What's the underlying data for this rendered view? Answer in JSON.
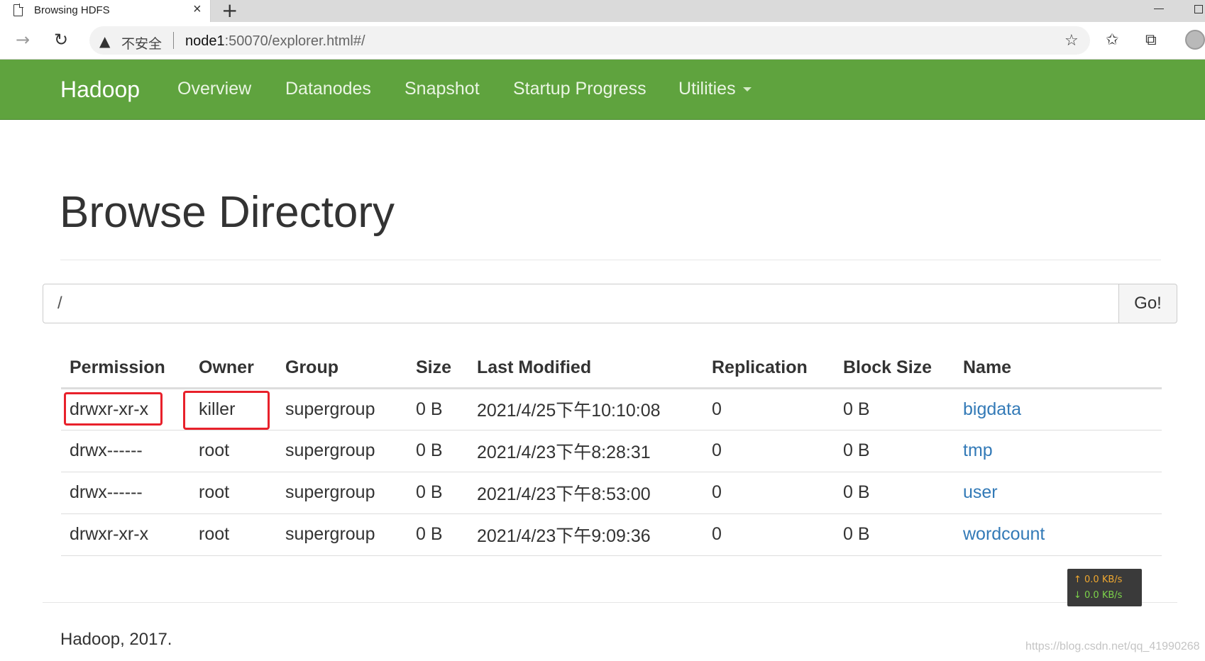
{
  "browser": {
    "tab_title": "Browsing HDFS",
    "tab_close": "×",
    "new_tab": "+",
    "insecure_label": "不安全",
    "url_host": "node1",
    "url_rest": ":50070/explorer.html#/"
  },
  "navbar": {
    "brand": "Hadoop",
    "items": [
      {
        "label": "Overview"
      },
      {
        "label": "Datanodes"
      },
      {
        "label": "Snapshot"
      },
      {
        "label": "Startup Progress"
      },
      {
        "label": "Utilities"
      }
    ]
  },
  "main": {
    "title": "Browse Directory",
    "path_value": "/",
    "go_label": "Go!"
  },
  "table": {
    "headers": [
      "Permission",
      "Owner",
      "Group",
      "Size",
      "Last Modified",
      "Replication",
      "Block Size",
      "Name"
    ],
    "rows": [
      [
        "drwxr-xr-x",
        "killer",
        "supergroup",
        "0 B",
        "2021/4/25下午10:10:08",
        "0",
        "0 B",
        "bigdata"
      ],
      [
        "drwx------",
        "root",
        "supergroup",
        "0 B",
        "2021/4/23下午8:28:31",
        "0",
        "0 B",
        "tmp"
      ],
      [
        "drwx------",
        "root",
        "supergroup",
        "0 B",
        "2021/4/23下午8:53:00",
        "0",
        "0 B",
        "user"
      ],
      [
        "drwxr-xr-x",
        "root",
        "supergroup",
        "0 B",
        "2021/4/23下午9:09:36",
        "0",
        "0 B",
        "wordcount"
      ]
    ]
  },
  "footer": {
    "text": "Hadoop, 2017."
  },
  "net_widget": {
    "up": "↑ 0.0 KB/s",
    "down": "↓ 0.0 KB/s"
  },
  "watermark": "https://blog.csdn.net/qq_41990268",
  "colors": {
    "navbar": "#5fa33e",
    "link": "#337ab7",
    "highlight": "#e8212b"
  }
}
